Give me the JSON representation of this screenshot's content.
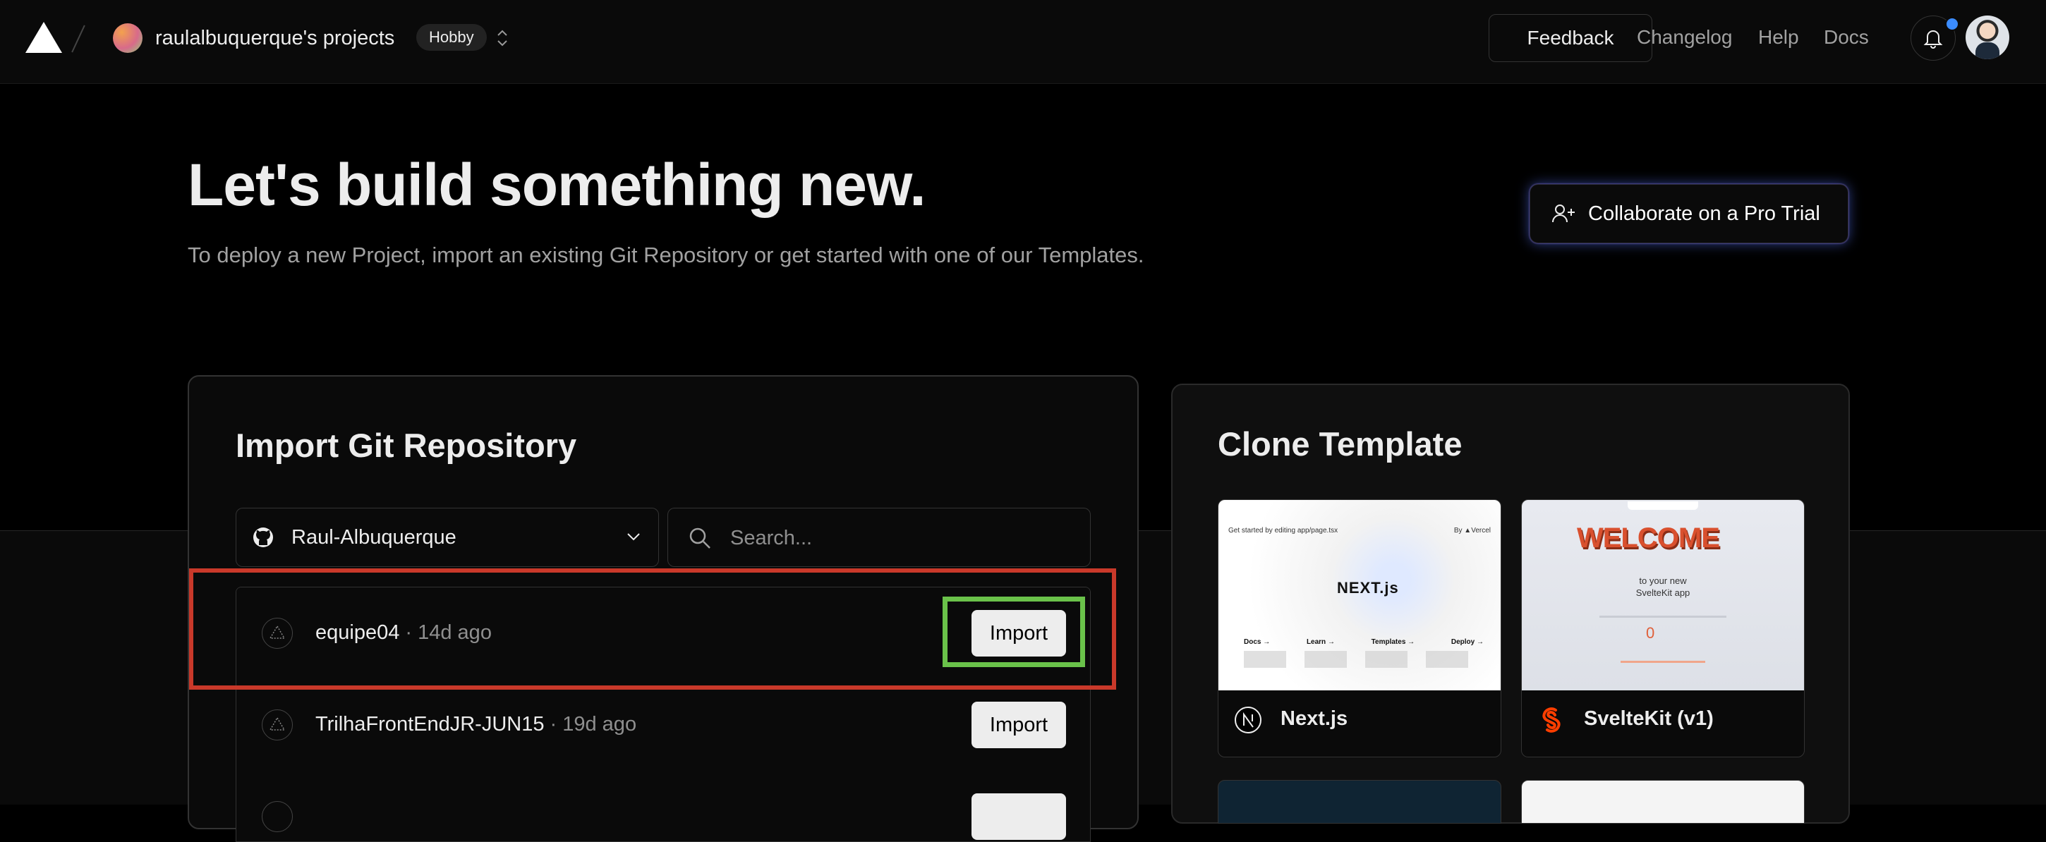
{
  "header": {
    "team_name": "raulalbuquerque's projects",
    "plan_badge": "Hobby",
    "nav": {
      "feedback": "Feedback",
      "changelog": "Changelog",
      "help": "Help",
      "docs": "Docs"
    }
  },
  "hero": {
    "title": "Let's build something new.",
    "subtitle": "To deploy a new Project, import an existing Git Repository or get started with one of our Templates.",
    "pro_trial_button": "Collaborate on a Pro Trial"
  },
  "import": {
    "title": "Import Git Repository",
    "account": "Raul-Albuquerque",
    "search_placeholder": "Search...",
    "repos": [
      {
        "name": "equipe04",
        "time": " · 14d ago",
        "button": "Import"
      },
      {
        "name": "TrilhaFrontEndJR-JUN15",
        "time": " · 19d ago",
        "button": "Import"
      },
      {
        "name": "",
        "time": "",
        "button": ""
      }
    ]
  },
  "clone": {
    "title": "Clone Template",
    "templates": [
      {
        "name": "Next.js",
        "icon": "nextjs-icon"
      },
      {
        "name": "SvelteKit (v1)",
        "icon": "svelte-icon"
      }
    ],
    "next_thumb": {
      "top_left": "Get started by editing app/page.tsx",
      "top_right": "By ▲Vercel",
      "logo": "NEXT.js",
      "cols": [
        "Docs →",
        "Learn →",
        "Templates →",
        "Deploy →"
      ]
    },
    "svelte_thumb": {
      "welcome": "WELCOME",
      "sub1": "to your new",
      "sub2": "SvelteKit app",
      "counter": "0"
    }
  },
  "colors": {
    "accent_blue": "#3b8cff",
    "highlight_red": "#c9392a",
    "highlight_green": "#6ac24a",
    "svelte_orange": "#ff3e00"
  }
}
